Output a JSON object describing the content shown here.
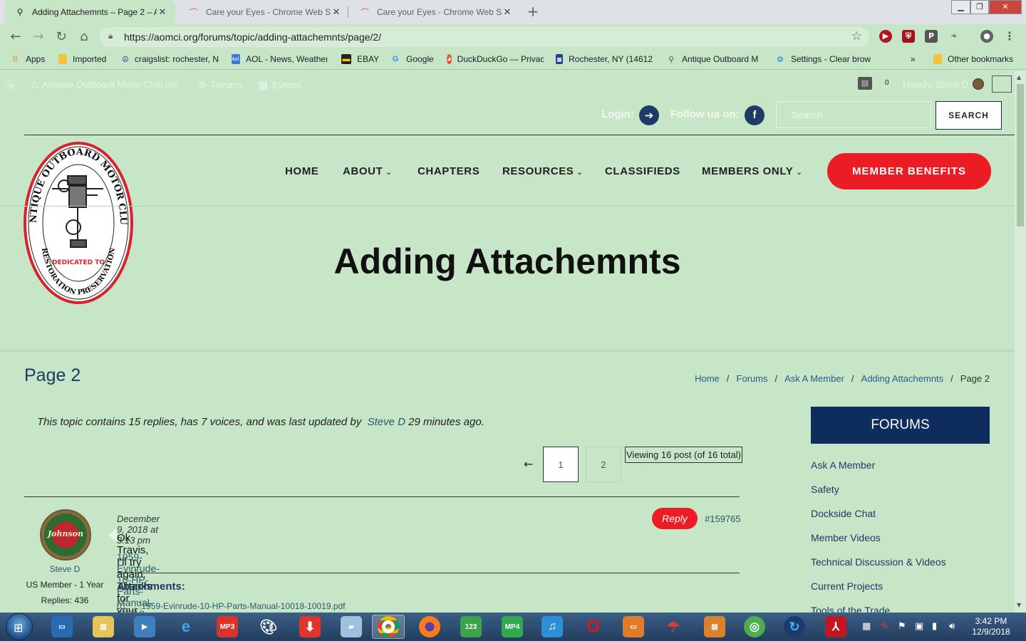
{
  "browser": {
    "tabs": [
      {
        "title": "Adding Attachemnts – Page 2 – A",
        "active": true,
        "favicon": "outboard-motor-icon"
      },
      {
        "title": "Care your Eyes - Chrome Web St",
        "active": false,
        "favicon": "rainbow-icon"
      },
      {
        "title": "Care your Eyes - Chrome Web St",
        "active": false,
        "favicon": "rainbow-icon"
      }
    ],
    "close_glyph": "✕",
    "new_tab_glyph": "+",
    "url": "https://aomci.org/forums/topic/adding-attachemnts/page/2/",
    "bookmarks": [
      {
        "label": "Apps",
        "icon": "apps-grid-icon"
      },
      {
        "label": "Imported",
        "icon": "folder-icon"
      },
      {
        "label": "craigslist: rochester, N",
        "icon": "peace-icon"
      },
      {
        "label": "AOL - News, Weather",
        "icon": "aol-icon"
      },
      {
        "label": "EBAY",
        "icon": "ebay-icon"
      },
      {
        "label": "Google",
        "icon": "google-icon"
      },
      {
        "label": "DuckDuckGo — Privac",
        "icon": "duckduckgo-icon"
      },
      {
        "label": "Rochester, NY (14612",
        "icon": "weather-icon"
      },
      {
        "label": "Antique Outboard M",
        "icon": "outboard-motor-icon"
      },
      {
        "label": "Settings - Clear brow",
        "icon": "settings-icon"
      }
    ],
    "bookmarks_overflow": "»",
    "other_bookmarks": "Other bookmarks"
  },
  "admin_bar": {
    "site_name": "Antique Outboard Motor Club,Inc",
    "forums": "Forums",
    "events": "Events",
    "notif_count": "0",
    "greeting": "Howdy, Steve D"
  },
  "header": {
    "login_label": "Login:",
    "follow_label": "Follow us on:",
    "search_placeholder": "Search",
    "search_button": "SEARCH"
  },
  "logo": {
    "top_text": "THE ANTIQUE OUTBOARD MOTOR CLUB INC",
    "middle_text": "DEDICATED TO",
    "bottom_text": "RESTORATION PRESERVATION"
  },
  "nav": {
    "items": [
      {
        "label": "HOME",
        "dropdown": false
      },
      {
        "label": "ABOUT",
        "dropdown": true
      },
      {
        "label": "CHAPTERS",
        "dropdown": false
      },
      {
        "label": "RESOURCES",
        "dropdown": true
      },
      {
        "label": "CLASSIFIEDS",
        "dropdown": false
      },
      {
        "label": "MEMBERS ONLY",
        "dropdown": true
      }
    ],
    "cta": "MEMBER BENEFITS"
  },
  "hero": {
    "title": "Adding Attachemnts"
  },
  "page": {
    "label": "Page 2",
    "breadcrumb": [
      "Home",
      "Forums",
      "Ask A Member",
      "Adding Attachemnts",
      "Page 2"
    ]
  },
  "topic": {
    "info_prefix": "This topic contains 15 replies, has 7 voices, and was last updated by",
    "info_author": "Steve D",
    "info_suffix": "29 minutes ago."
  },
  "pagination": {
    "prev": "←",
    "pages": [
      "1",
      "2"
    ],
    "viewing": "Viewing 16 post (of 16 total)"
  },
  "reply": {
    "avatar_text": "Johnson",
    "author": "Steve D",
    "role": "US Member - 1 Year",
    "replies": "Replies: 436",
    "date": "December 9, 2018 at 3:13 pm",
    "reply_button": "Reply",
    "post_id": "#159765",
    "body": "Ok Travis, I'll try again. Thanks for your help.",
    "link": "1959-Evinrude-10-HP-Parts-Manual-10018-10019",
    "attachments_label": "Attachments:",
    "attachment_num": "01.",
    "attachment_file": "1959-Evinrude-10-HP-Parts-Manual-10018-10019.pdf"
  },
  "sidebar": {
    "title": "FORUMS",
    "links": [
      "Ask A Member",
      "Safety",
      "Dockside Chat",
      "Member Videos",
      "Technical Discussion & Videos",
      "Current Projects",
      "Tools of the Trade"
    ]
  },
  "taskbar": {
    "clock_time": "3:42 PM",
    "clock_date": "12/9/2018"
  },
  "colors": {
    "page_bg": "#c7e5c7",
    "brand_navy": "#0f2c5e",
    "brand_red": "#ec1c24"
  }
}
